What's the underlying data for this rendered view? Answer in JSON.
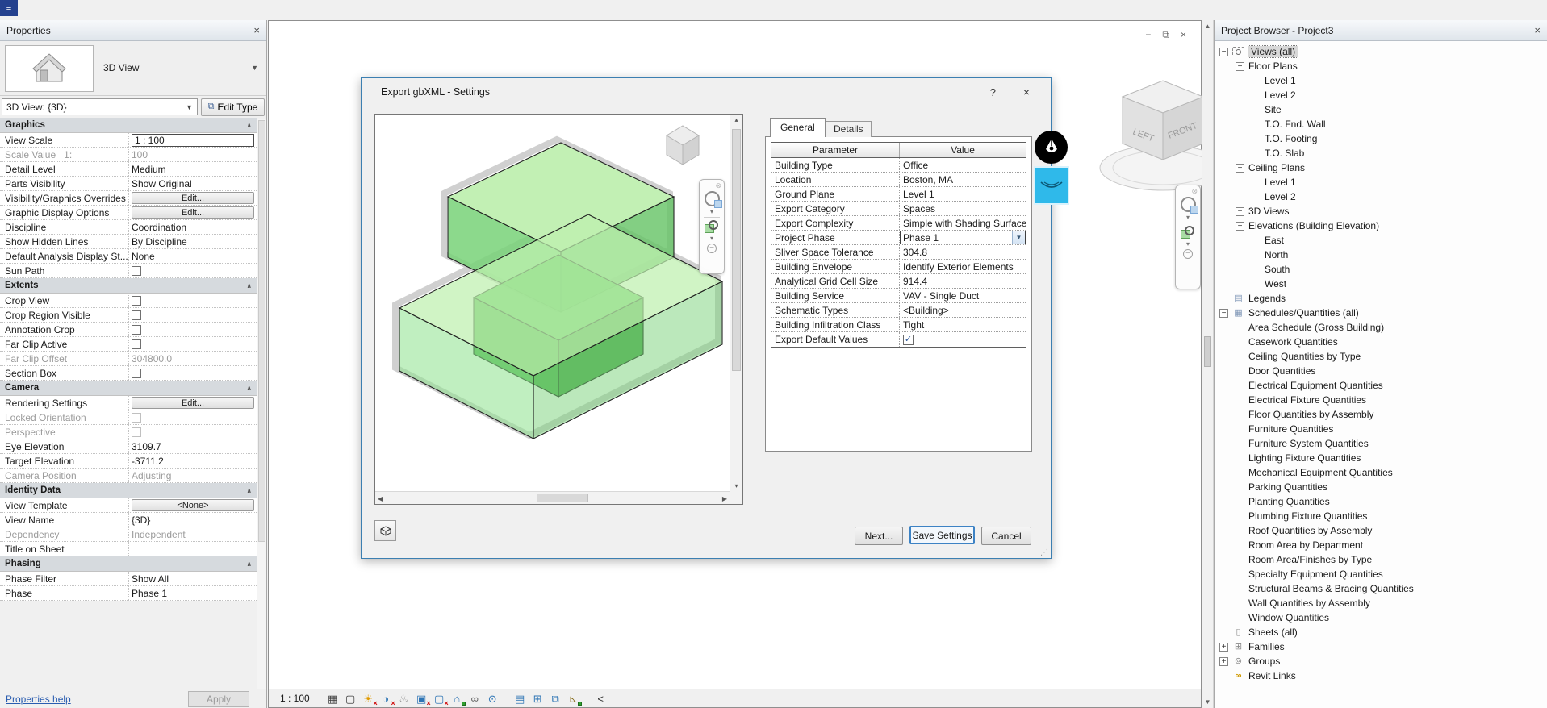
{
  "properties": {
    "title": "Properties",
    "type_label": "3D View",
    "selector_value": "3D View: {3D}",
    "edit_type_label": "Edit Type",
    "help_link": "Properties help",
    "apply_label": "Apply",
    "sections": [
      {
        "header": "Graphics",
        "rows": [
          {
            "label": "View Scale",
            "value": "1 : 100",
            "type": "boxed"
          },
          {
            "label": "Scale Value   1:",
            "value": "100",
            "type": "text",
            "dim": true
          },
          {
            "label": "Detail Level",
            "value": "Medium",
            "type": "text"
          },
          {
            "label": "Parts Visibility",
            "value": "Show Original",
            "type": "text"
          },
          {
            "label": "Visibility/Graphics Overrides",
            "value": "Edit...",
            "type": "edit"
          },
          {
            "label": "Graphic Display Options",
            "value": "Edit...",
            "type": "edit"
          },
          {
            "label": "Discipline",
            "value": "Coordination",
            "type": "text"
          },
          {
            "label": "Show Hidden Lines",
            "value": "By Discipline",
            "type": "text"
          },
          {
            "label": "Default Analysis Display St...",
            "value": "None",
            "type": "text"
          },
          {
            "label": "Sun Path",
            "type": "checkbox"
          }
        ]
      },
      {
        "header": "Extents",
        "rows": [
          {
            "label": "Crop View",
            "type": "checkbox"
          },
          {
            "label": "Crop Region Visible",
            "type": "checkbox"
          },
          {
            "label": "Annotation Crop",
            "type": "checkbox"
          },
          {
            "label": "Far Clip Active",
            "type": "checkbox"
          },
          {
            "label": "Far Clip Offset",
            "value": "304800.0",
            "type": "text",
            "dim": true
          },
          {
            "label": "Section Box",
            "type": "checkbox"
          }
        ]
      },
      {
        "header": "Camera",
        "rows": [
          {
            "label": "Rendering Settings",
            "value": "Edit...",
            "type": "edit"
          },
          {
            "label": "Locked Orientation",
            "type": "checkbox",
            "dim": true
          },
          {
            "label": "Perspective",
            "type": "checkbox",
            "dim": true
          },
          {
            "label": "Eye Elevation",
            "value": "3109.7",
            "type": "text"
          },
          {
            "label": "Target Elevation",
            "value": "-3711.2",
            "type": "text"
          },
          {
            "label": "Camera Position",
            "value": "Adjusting",
            "type": "text",
            "dim": true
          }
        ]
      },
      {
        "header": "Identity Data",
        "rows": [
          {
            "label": "View Template",
            "value": "<None>",
            "type": "edit"
          },
          {
            "label": "View Name",
            "value": "{3D}",
            "type": "text"
          },
          {
            "label": "Dependency",
            "value": "Independent",
            "type": "text",
            "dim": true
          },
          {
            "label": "Title on Sheet",
            "value": "",
            "type": "text"
          }
        ]
      },
      {
        "header": "Phasing",
        "rows": [
          {
            "label": "Phase Filter",
            "value": "Show All",
            "type": "text"
          },
          {
            "label": "Phase",
            "value": "Phase 1",
            "type": "text"
          }
        ]
      }
    ]
  },
  "dialog": {
    "title": "Export gbXML - Settings",
    "help_glyph": "?",
    "tabs": [
      {
        "label": "General"
      },
      {
        "label": "Details"
      }
    ],
    "table": {
      "param_header": "Parameter",
      "value_header": "Value",
      "rows": [
        {
          "param": "Building Type",
          "value": "Office",
          "type": "text"
        },
        {
          "param": "Location",
          "value": "Boston, MA",
          "type": "text"
        },
        {
          "param": "Ground Plane",
          "value": "Level 1",
          "type": "text"
        },
        {
          "param": "Export Category",
          "value": "Spaces",
          "type": "text"
        },
        {
          "param": "Export Complexity",
          "value": "Simple with Shading Surface",
          "type": "text"
        },
        {
          "param": "Project Phase",
          "value": "Phase 1",
          "type": "combo"
        },
        {
          "param": "Sliver Space Tolerance",
          "value": "304.8",
          "type": "text"
        },
        {
          "param": "Building Envelope",
          "value": "Identify Exterior Elements",
          "type": "text"
        },
        {
          "param": "Analytical Grid Cell Size",
          "value": "914.4",
          "type": "text"
        },
        {
          "param": "Building Service",
          "value": "VAV - Single Duct",
          "type": "text"
        },
        {
          "param": "Schematic Types",
          "value": "<Building>",
          "type": "text"
        },
        {
          "param": "Building Infiltration Class",
          "value": "Tight",
          "type": "text"
        },
        {
          "param": "Export Default Values",
          "value": "checked",
          "type": "check"
        }
      ]
    },
    "buttons": {
      "next": "Next...",
      "save": "Save Settings",
      "cancel": "Cancel"
    }
  },
  "canvas": {
    "scale_label": "1 : 100",
    "viewcube": {
      "left": "LEFT",
      "front": "FRONT"
    },
    "viewbar": [
      {
        "name": "detail-level-icon",
        "glyph": "▦",
        "color": "#3a3a3a"
      },
      {
        "name": "visual-style-icon",
        "glyph": "▢",
        "color": "#3a3a3a"
      },
      {
        "name": "sun-path-icon",
        "glyph": "☀",
        "color": "#e09a00",
        "badge": "x"
      },
      {
        "name": "shadows-icon",
        "glyph": "◑",
        "color": "#2e75b5",
        "badge": "x"
      },
      {
        "name": "rendering-dialog-icon",
        "glyph": "♨",
        "color": "#777777"
      },
      {
        "name": "crop-view-icon",
        "glyph": "▣",
        "color": "#2e75b5",
        "badge": "x"
      },
      {
        "name": "crop-region-icon",
        "glyph": "▢",
        "color": "#2e75b5",
        "badge": "x"
      },
      {
        "name": "lock-3d-view-icon",
        "glyph": "⌂",
        "color": "#2e75b5",
        "badge": "lock"
      },
      {
        "name": "temporary-hide-isolate-icon",
        "glyph": "∞",
        "color": "#555555"
      },
      {
        "name": "reveal-hidden-elements-icon",
        "glyph": "⊙",
        "color": "#2e75b5"
      },
      {
        "name": "temporary-view-properties-icon",
        "glyph": "▤",
        "color": "#2e75b5",
        "gap": true
      },
      {
        "name": "analytical-model-icon",
        "glyph": "⊞",
        "color": "#2e75b5"
      },
      {
        "name": "displacement-sets-icon",
        "glyph": "⧉",
        "color": "#2e75b5"
      },
      {
        "name": "reveal-constraints-icon",
        "glyph": "⊾",
        "color": "#7a5c00",
        "badge": "lock"
      },
      {
        "name": "expand-viewbar-icon",
        "glyph": "<",
        "color": "#333333",
        "gap": true
      }
    ]
  },
  "browser": {
    "title": "Project Browser - Project3",
    "items": [
      {
        "level": 0,
        "exp": "minus",
        "icon": "views",
        "label": "Views (all)",
        "selected": true
      },
      {
        "level": 1,
        "exp": "minus",
        "label": "Floor Plans"
      },
      {
        "level": 2,
        "label": "Level 1"
      },
      {
        "level": 2,
        "label": "Level 2"
      },
      {
        "level": 2,
        "label": "Site"
      },
      {
        "level": 2,
        "label": "T.O. Fnd. Wall"
      },
      {
        "level": 2,
        "label": "T.O. Footing"
      },
      {
        "level": 2,
        "label": "T.O. Slab"
      },
      {
        "level": 1,
        "exp": "minus",
        "label": "Ceiling Plans"
      },
      {
        "level": 2,
        "label": "Level 1"
      },
      {
        "level": 2,
        "label": "Level 2"
      },
      {
        "level": 1,
        "exp": "plus",
        "label": "3D Views"
      },
      {
        "level": 1,
        "exp": "minus",
        "label": "Elevations (Building Elevation)"
      },
      {
        "level": 2,
        "label": "East"
      },
      {
        "level": 2,
        "label": "North"
      },
      {
        "level": 2,
        "label": "South"
      },
      {
        "level": 2,
        "label": "West"
      },
      {
        "level": 0,
        "icon": "legends",
        "label": "Legends"
      },
      {
        "level": 0,
        "exp": "minus",
        "icon": "schedules",
        "label": "Schedules/Quantities (all)"
      },
      {
        "level": 1,
        "label": "Area Schedule (Gross Building)"
      },
      {
        "level": 1,
        "label": "Casework Quantities"
      },
      {
        "level": 1,
        "label": "Ceiling Quantities by Type"
      },
      {
        "level": 1,
        "label": "Door Quantities"
      },
      {
        "level": 1,
        "label": "Electrical Equipment Quantities"
      },
      {
        "level": 1,
        "label": "Electrical Fixture Quantities"
      },
      {
        "level": 1,
        "label": "Floor Quantities by Assembly"
      },
      {
        "level": 1,
        "label": "Furniture Quantities"
      },
      {
        "level": 1,
        "label": "Furniture System Quantities"
      },
      {
        "level": 1,
        "label": "Lighting Fixture Quantities"
      },
      {
        "level": 1,
        "label": "Mechanical Equipment Quantities"
      },
      {
        "level": 1,
        "label": "Parking Quantities"
      },
      {
        "level": 1,
        "label": "Planting Quantities"
      },
      {
        "level": 1,
        "label": "Plumbing Fixture Quantities"
      },
      {
        "level": 1,
        "label": "Roof Quantities by Assembly"
      },
      {
        "level": 1,
        "label": "Room Area by Department"
      },
      {
        "level": 1,
        "label": "Room Area/Finishes by Type"
      },
      {
        "level": 1,
        "label": "Specialty Equipment Quantities"
      },
      {
        "level": 1,
        "label": "Structural Beams & Bracing Quantities"
      },
      {
        "level": 1,
        "label": "Wall Quantities by Assembly"
      },
      {
        "level": 1,
        "label": "Window Quantities"
      },
      {
        "level": 0,
        "icon": "sheets",
        "label": "Sheets (all)"
      },
      {
        "level": 0,
        "exp": "plus",
        "icon": "families",
        "label": "Families"
      },
      {
        "level": 0,
        "exp": "plus",
        "icon": "groups",
        "label": "Groups"
      },
      {
        "level": 0,
        "icon": "links",
        "label": "Revit Links"
      }
    ]
  }
}
